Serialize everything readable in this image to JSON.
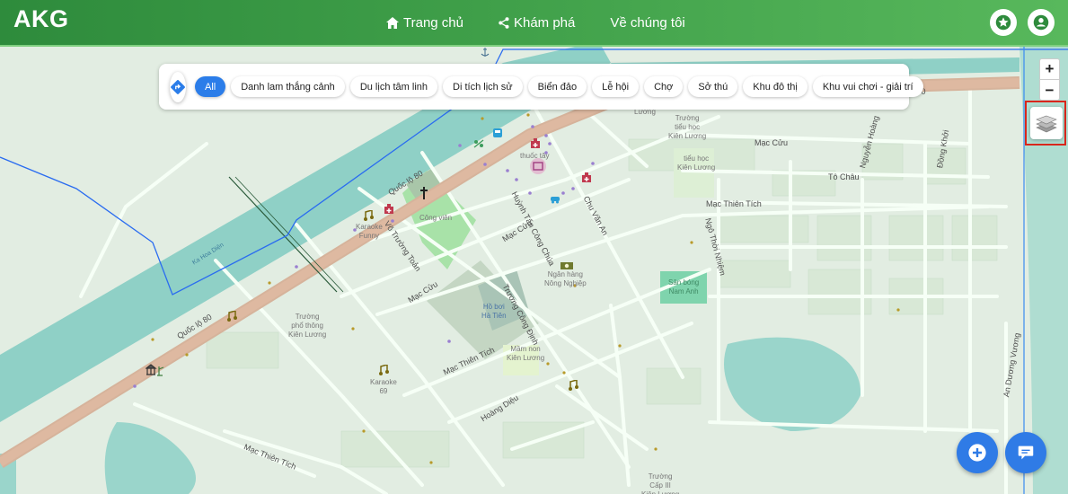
{
  "app": {
    "logo": "AKG"
  },
  "nav": [
    {
      "label": "Trang chủ",
      "icon": "home-icon"
    },
    {
      "label": "Khám phá",
      "icon": "share-icon"
    },
    {
      "label": "Về chúng tôi",
      "icon": ""
    }
  ],
  "header_actions": {
    "favorites_icon": "star-icon",
    "account_icon": "user-icon"
  },
  "filters": {
    "direction_icon": "directions-icon",
    "chips": [
      "All",
      "Danh lam thắng cảnh",
      "Du lịch tâm linh",
      "Di tích lịch sử",
      "Biển đảo",
      "Lễ hội",
      "Chợ",
      "Sở thú",
      "Khu đô thị",
      "Khu vui chơi - giải trí"
    ],
    "active": "All"
  },
  "map_controls": {
    "zoom_in": "+",
    "zoom_out": "−",
    "layers_icon": "layers-icon"
  },
  "fabs": {
    "add_icon": "plus-circle-icon",
    "chat_icon": "chat-icon"
  },
  "colors": {
    "header_start": "#2e8b3c",
    "header_end": "#58b85c",
    "accent": "#2b7de9",
    "highlight": "#d9261c",
    "road_main": "#d9b39a",
    "water": "#8fd0c6"
  },
  "map": {
    "roads": {
      "ql80_a": "Quốc lộ 80",
      "ql80_b": "Quốc lộ 80",
      "ql80_c": "lộ 80",
      "vo_truong_toan": "Võ Trường Toản",
      "huynh_tan": "Huỳnh Tấn Công Chúa",
      "mac_cuu_1": "Mạc Cửu",
      "mac_cuu_2": "Mạc Cửu",
      "mac_cuu_3": "Mạc Cửu",
      "chu_van_an": "Chu Văn An",
      "truong_cong_dinh": "Trương Công Định",
      "mac_thien_tich_1": "Mạc Thiên Tích",
      "mac_thien_tich_2": "Mạc Thiên Tích",
      "mac_thien_tich_3": "Mạc Thiên Tích",
      "hoang_dieu": "Hoàng Diệu",
      "to_chau": "Tô Châu",
      "ngo_thoi_nhiem": "Ngô Thời Nhiệm",
      "nguyen_hoang": "Nguyễn Hoàng",
      "dong_khoi": "Đồng Khởi",
      "an_duong_vuong": "An Dương Vương",
      "ka_hoa_dien": "Ka Hoa Diện"
    },
    "places": {
      "cong_vien": "Công viên",
      "thuoc_tay": "thuốc tây",
      "karaoke_funny": "Karaoke\nFunny",
      "karaoke_69": "Karaoke\n69",
      "ngan_hang": "Ngân hàng\nNông Nghiệp",
      "ho_boi": "Hồ bơi\nHà Tiên",
      "mam_non": "Mầm non\nKiên Lương",
      "truong_pt": "Trường\nphổ thông\nKiên Lương",
      "th_kl_1": "Trường\ntiểu học\nKiên Lương",
      "th_kl_2": "tiểu học\nKiên Lương",
      "san_bong": "Sân bóng\nNam Anh",
      "luong": "Lương",
      "cap3": "Trường\nCấp III\nKiên Lương"
    }
  }
}
